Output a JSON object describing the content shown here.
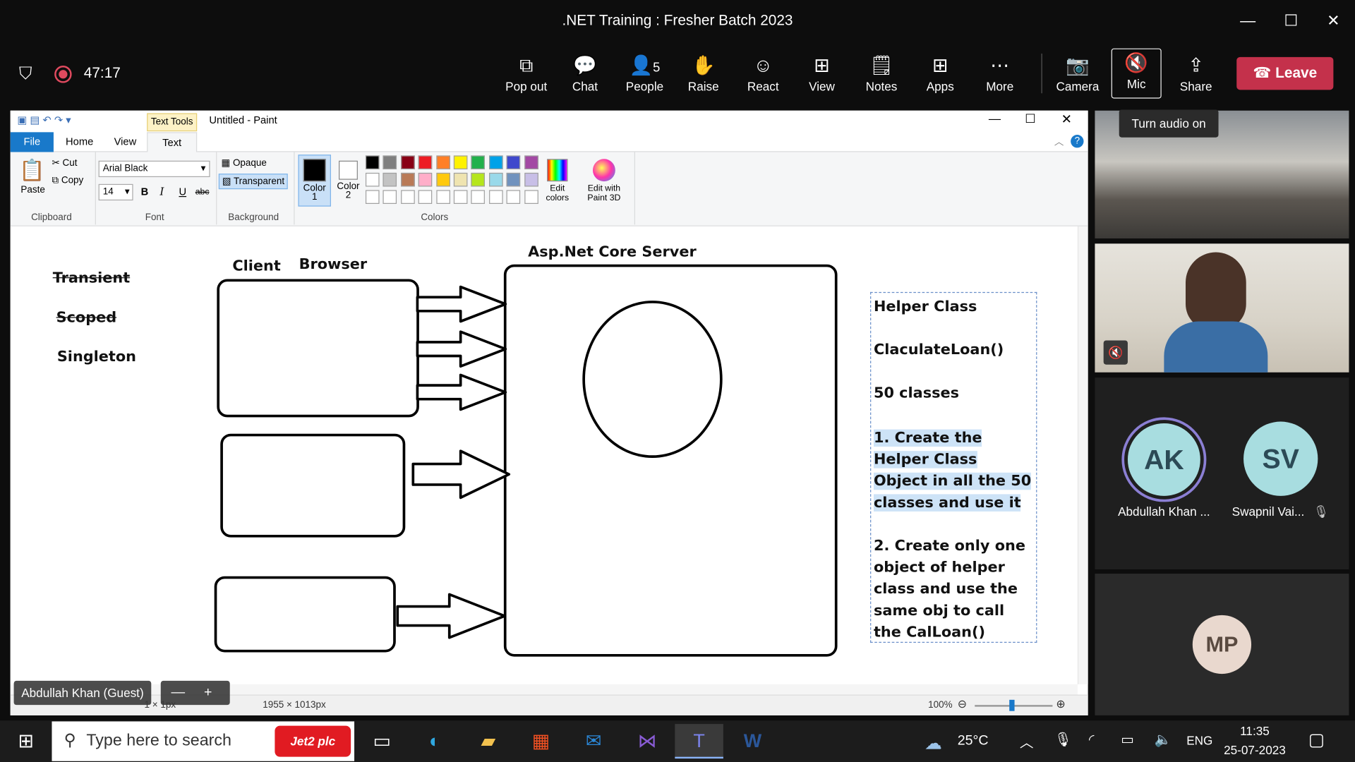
{
  "window": {
    "title": ".NET Training : Fresher Batch 2023"
  },
  "meeting": {
    "timer": "47:17",
    "people_count": "5",
    "tooltip": "Turn audio on"
  },
  "toolbar": {
    "pop_out": "Pop out",
    "chat": "Chat",
    "people": "People",
    "raise": "Raise",
    "react": "React",
    "view": "View",
    "notes": "Notes",
    "apps": "Apps",
    "more": "More",
    "camera": "Camera",
    "mic": "Mic",
    "share": "Share",
    "leave": "Leave"
  },
  "paint": {
    "tab_text_tools": "Text Tools",
    "doc_title": "Untitled - Paint",
    "tabs": {
      "file": "File",
      "home": "Home",
      "view": "View",
      "text": "Text"
    },
    "clipboard": {
      "paste": "Paste",
      "cut": "Cut",
      "copy": "Copy",
      "label": "Clipboard"
    },
    "font": {
      "family": "Arial Black",
      "size": "14",
      "label": "Font",
      "bold": "B",
      "italic": "I",
      "underline": "U",
      "strike": "abc"
    },
    "background": {
      "opaque": "Opaque",
      "transparent": "Transparent",
      "label": "Background"
    },
    "colors": {
      "color1": "Color",
      "color1_n": "1",
      "color2": "Color",
      "color2_n": "2",
      "edit": "Edit",
      "edit2": "colors",
      "paint3d": "Edit with",
      "paint3d2": "Paint 3D",
      "label": "Colors"
    },
    "swatches": [
      "#000000",
      "#7f7f7f",
      "#880015",
      "#ed1c24",
      "#ff7f27",
      "#fff200",
      "#22b14c",
      "#00a2e8",
      "#3f48cc",
      "#a349a4",
      "#ffffff",
      "#c3c3c3",
      "#b97a57",
      "#ffaec9",
      "#ffc90e",
      "#efe4b0",
      "#b5e61d",
      "#99d9ea",
      "#7092be",
      "#c8bfe7"
    ],
    "status": {
      "pos": "1 × 1px",
      "size": "1955 × 1013px",
      "zoom": "100%"
    }
  },
  "canvas": {
    "transient": "Transient",
    "scoped": "Scoped",
    "singleton": "Singleton",
    "client": "Client",
    "browser": "Browser",
    "server": "Asp.Net Core Server",
    "lines": [
      "Helper Class",
      "ClaculateLoan()",
      "50 classes"
    ],
    "point1": [
      "1. Create the",
      "Helper Class",
      "Object in all the 50",
      "classes and use it"
    ],
    "point2": [
      "2. Create only one",
      "object of helper",
      "class and use the",
      "same obj to call",
      "the CalLoan()"
    ]
  },
  "participants": {
    "ak_initials": "AK",
    "ak_name": "Abdullah Khan ...",
    "sv_initials": "SV",
    "sv_name": "Swapnil Vai...",
    "mp_initials": "MP",
    "guest_label": "Abdullah Khan (Guest)"
  },
  "taskbar": {
    "search_placeholder": "Type here to search",
    "ad": "Jet2 plc",
    "weather": "25°C",
    "lang": "ENG",
    "time": "11:35",
    "date": "25-07-2023"
  }
}
